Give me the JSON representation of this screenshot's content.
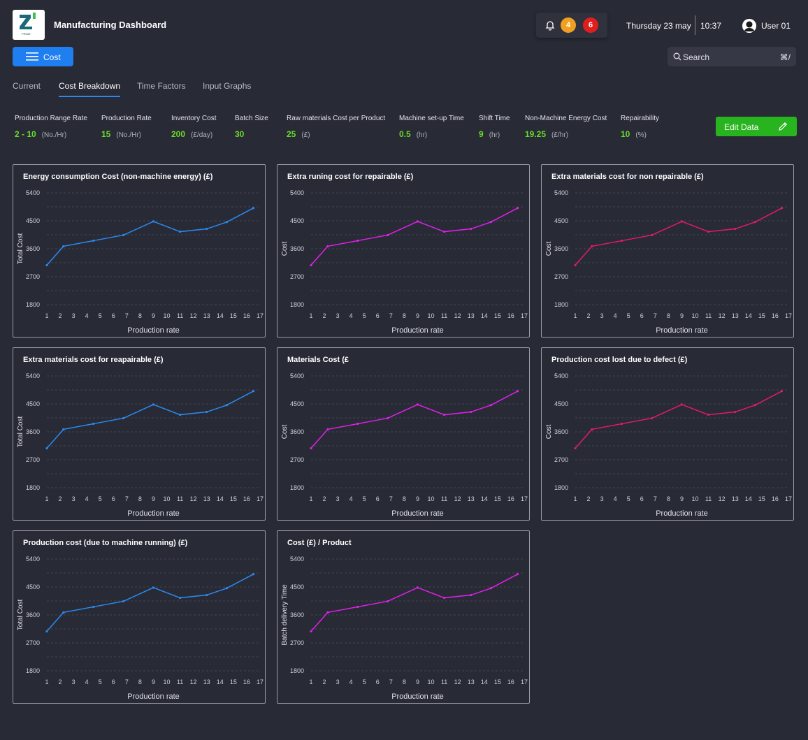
{
  "header": {
    "app_title": "Manufacturing Dashboard",
    "logo_text": "PRIME",
    "notification_icon": "bell-icon",
    "badges": [
      "4",
      "6"
    ],
    "badge_colors": [
      "#f0a020",
      "#e01e1e"
    ],
    "date": "Thursday 23 may",
    "time": "10:37",
    "user_name": "User 01"
  },
  "menu_button": {
    "label": "Cost",
    "icon": "menu-icon",
    "color": "#1f7ef0"
  },
  "search": {
    "placeholder": "Search",
    "shortcut": "⌘/",
    "icon": "search-icon"
  },
  "tabs": [
    {
      "label": "Current",
      "active": false
    },
    {
      "label": "Cost Breakdown",
      "active": true
    },
    {
      "label": "Time Factors",
      "active": false
    },
    {
      "label": "Input Graphs",
      "active": false
    }
  ],
  "parameters": [
    {
      "label": "Production Range Rate",
      "value": "2 - 10",
      "unit": "(No./Hr)"
    },
    {
      "label": "Production  Rate",
      "value": "15",
      "unit": "(No./Hr)"
    },
    {
      "label": "Inventory Cost",
      "value": "200",
      "unit": "(£/day)"
    },
    {
      "label": "Batch Size",
      "value": "30",
      "unit": ""
    },
    {
      "label": "Raw materials Cost per Product",
      "value": "25",
      "unit": "(£)"
    },
    {
      "label": "Machine set-up Time",
      "value": "0.5",
      "unit": "(hr)"
    },
    {
      "label": "Shift Time",
      "value": "9",
      "unit": "(hr)"
    },
    {
      "label": "Non-Machine Energy Cost",
      "value": "19.25",
      "unit": "(£/hr)"
    },
    {
      "label": "Repairability",
      "value": "10",
      "unit": "(%)"
    }
  ],
  "edit_button": {
    "label": "Edit Data",
    "icon": "pencil-icon",
    "color": "#28b41e"
  },
  "colors": {
    "accent_value": "#6adc27",
    "blue_series": "#2b8af0",
    "magenta_series": "#e020e8",
    "pink_series": "#e5186e"
  },
  "chart_data": [
    {
      "type": "line",
      "title": "Energy consumption Cost (non-machine energy) (£)",
      "xlabel": "Production rate",
      "ylabel": "Total Cost",
      "x": [
        1,
        2.25,
        4.5,
        6.75,
        9,
        11,
        13,
        14.5,
        16.5
      ],
      "y": [
        3070,
        3680,
        3860,
        4040,
        4480,
        4150,
        4240,
        4460,
        4910
      ],
      "xticks": [
        1,
        2,
        3,
        4,
        5,
        6,
        7,
        8,
        9,
        10,
        11,
        12,
        13,
        14,
        15,
        16,
        17
      ],
      "yticks": [
        1800,
        2700,
        3600,
        4500,
        5400
      ],
      "xlim": [
        1,
        17
      ],
      "ylim": [
        1800,
        5400
      ],
      "color": "#2b8af0",
      "grid": true
    },
    {
      "type": "line",
      "title": "Extra runing cost for repairable (£)",
      "xlabel": "Production rate",
      "ylabel": "Cost",
      "x": [
        1,
        2.25,
        4.5,
        6.75,
        9,
        11,
        13,
        14.5,
        16.5
      ],
      "y": [
        3070,
        3680,
        3860,
        4040,
        4480,
        4150,
        4240,
        4460,
        4910
      ],
      "xticks": [
        1,
        2,
        3,
        4,
        5,
        6,
        7,
        8,
        9,
        10,
        11,
        12,
        13,
        14,
        15,
        16,
        17
      ],
      "yticks": [
        1800,
        2700,
        3600,
        4500,
        5400
      ],
      "xlim": [
        1,
        17
      ],
      "ylim": [
        1800,
        5400
      ],
      "color": "#e020e8",
      "grid": true
    },
    {
      "type": "line",
      "title": "Extra materials cost for non repairable (£)",
      "xlabel": "Production rate",
      "ylabel": "Cost",
      "x": [
        1,
        2.25,
        4.5,
        6.75,
        9,
        11,
        13,
        14.5,
        16.5
      ],
      "y": [
        3070,
        3680,
        3860,
        4040,
        4480,
        4150,
        4240,
        4460,
        4910
      ],
      "xticks": [
        1,
        2,
        3,
        4,
        5,
        6,
        7,
        8,
        9,
        10,
        11,
        12,
        13,
        14,
        15,
        16,
        17
      ],
      "yticks": [
        1800,
        2700,
        3600,
        4500,
        5400
      ],
      "xlim": [
        1,
        17
      ],
      "ylim": [
        1800,
        5400
      ],
      "color": "#e5186e",
      "grid": true
    },
    {
      "type": "line",
      "title": "Extra materials cost for reapairable (£)",
      "xlabel": "Production rate",
      "ylabel": "Total Cost",
      "x": [
        1,
        2.25,
        4.5,
        6.75,
        9,
        11,
        13,
        14.5,
        16.5
      ],
      "y": [
        3070,
        3680,
        3860,
        4040,
        4480,
        4150,
        4240,
        4460,
        4910
      ],
      "xticks": [
        1,
        2,
        3,
        4,
        5,
        6,
        7,
        8,
        9,
        10,
        11,
        12,
        13,
        14,
        15,
        16,
        17
      ],
      "yticks": [
        1800,
        2700,
        3600,
        4500,
        5400
      ],
      "xlim": [
        1,
        17
      ],
      "ylim": [
        1800,
        5400
      ],
      "color": "#2b8af0",
      "grid": true
    },
    {
      "type": "line",
      "title": "Materials Cost (£",
      "xlabel": "Production rate",
      "ylabel": "Cost",
      "x": [
        1,
        2.25,
        4.5,
        6.75,
        9,
        11,
        13,
        14.5,
        16.5
      ],
      "y": [
        3070,
        3680,
        3860,
        4040,
        4480,
        4150,
        4240,
        4460,
        4910
      ],
      "xticks": [
        1,
        2,
        3,
        4,
        5,
        6,
        7,
        8,
        9,
        10,
        11,
        12,
        13,
        14,
        15,
        16,
        17
      ],
      "yticks": [
        1800,
        2700,
        3600,
        4500,
        5400
      ],
      "xlim": [
        1,
        17
      ],
      "ylim": [
        1800,
        5400
      ],
      "color": "#e020e8",
      "grid": true
    },
    {
      "type": "line",
      "title": "Production cost lost due to defect (£)",
      "xlabel": "Production rate",
      "ylabel": "Cost",
      "x": [
        1,
        2.25,
        4.5,
        6.75,
        9,
        11,
        13,
        14.5,
        16.5
      ],
      "y": [
        3070,
        3680,
        3860,
        4040,
        4480,
        4150,
        4240,
        4460,
        4910
      ],
      "xticks": [
        1,
        2,
        3,
        4,
        5,
        6,
        7,
        8,
        9,
        10,
        11,
        12,
        13,
        14,
        15,
        16,
        17
      ],
      "yticks": [
        1800,
        2700,
        3600,
        4500,
        5400
      ],
      "xlim": [
        1,
        17
      ],
      "ylim": [
        1800,
        5400
      ],
      "color": "#e5186e",
      "grid": true
    },
    {
      "type": "line",
      "title": "Production cost (due to machine running) (£)",
      "xlabel": "Production rate",
      "ylabel": "Total Cost",
      "x": [
        1,
        2.25,
        4.5,
        6.75,
        9,
        11,
        13,
        14.5,
        16.5
      ],
      "y": [
        3070,
        3680,
        3860,
        4040,
        4480,
        4150,
        4240,
        4460,
        4910
      ],
      "xticks": [
        1,
        2,
        3,
        4,
        5,
        6,
        7,
        8,
        9,
        10,
        11,
        12,
        13,
        14,
        15,
        16,
        17
      ],
      "yticks": [
        1800,
        2700,
        3600,
        4500,
        5400
      ],
      "xlim": [
        1,
        17
      ],
      "ylim": [
        1800,
        5400
      ],
      "color": "#2b8af0",
      "grid": true
    },
    {
      "type": "line",
      "title": "Cost (£) / Product",
      "xlabel": "Production rate",
      "ylabel": "Batch delivery Time",
      "x": [
        1,
        2.25,
        4.5,
        6.75,
        9,
        11,
        13,
        14.5,
        16.5
      ],
      "y": [
        3070,
        3680,
        3860,
        4040,
        4480,
        4150,
        4240,
        4460,
        4910
      ],
      "xticks": [
        1,
        2,
        3,
        4,
        5,
        6,
        7,
        8,
        9,
        10,
        11,
        12,
        13,
        14,
        15,
        16,
        17
      ],
      "yticks": [
        1800,
        2700,
        3600,
        4500,
        5400
      ],
      "xlim": [
        1,
        17
      ],
      "ylim": [
        1800,
        5400
      ],
      "color": "#e020e8",
      "grid": true
    }
  ]
}
